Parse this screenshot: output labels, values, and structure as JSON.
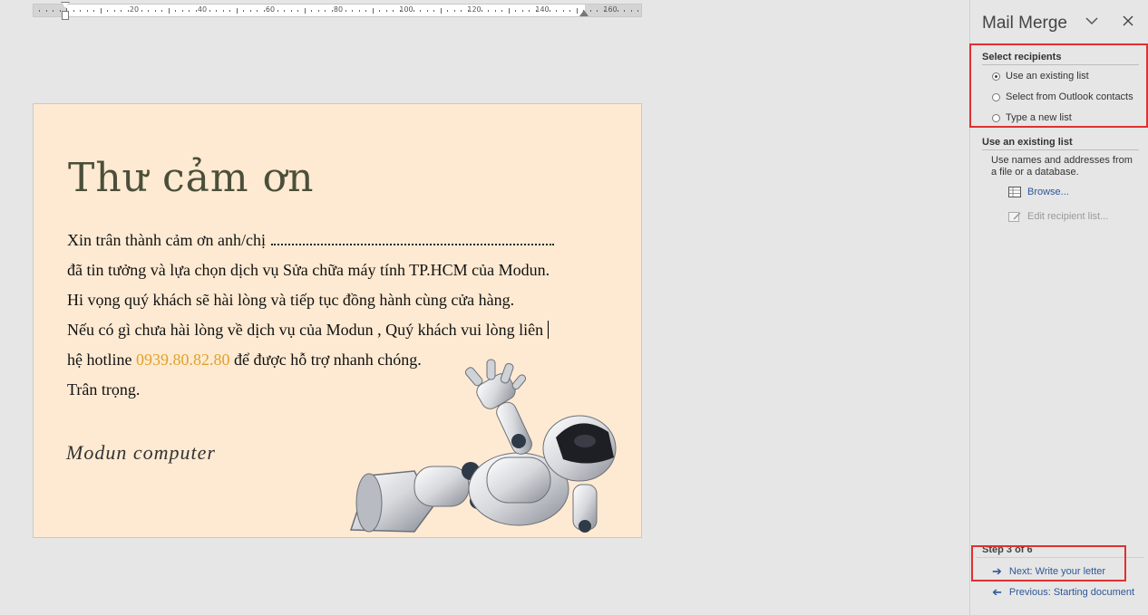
{
  "ruler": {
    "numbers": [
      "20",
      "40",
      "60",
      "80",
      "100",
      "120",
      "140",
      "160"
    ]
  },
  "document": {
    "title": "Thư cảm ơn",
    "line1": "Xin trân thành cảm ơn anh/chị",
    "line2": "đã tin tưởng và  lựa chọn dịch vụ Sửa chữa máy tính TP.HCM của Modun.",
    "line3": "Hi vọng quý khách sẽ hài lòng và tiếp tục đồng hành cùng cửa hàng.",
    "line4": "Nếu có gì chưa hài lòng về dịch vụ của Modun , Quý khách vui lòng liên",
    "line5_prefix": "hệ hotline ",
    "hotline": "0939.80.82.80",
    "line5_suffix": " để được hỗ trợ nhanh chóng.",
    "line6": "Trân trọng.",
    "signature": "Modun computer",
    "robot_image": "reclining-robot-illustration"
  },
  "mail_merge": {
    "title": "Mail Merge",
    "chevron_icon": "chevron-down-icon",
    "close_icon": "close-icon",
    "select_recipients_heading": "Select recipients",
    "options": [
      {
        "label": "Use an existing list",
        "selected": true
      },
      {
        "label": "Select from Outlook contacts",
        "selected": false
      },
      {
        "label": "Type a new list",
        "selected": false
      }
    ],
    "existing_list_heading": "Use an existing list",
    "existing_list_desc": "Use names and addresses from a file or a database.",
    "browse_label": "Browse...",
    "edit_label": "Edit recipient list...",
    "step_label": "Step 3 of 6",
    "next_label": "Next: Write your letter",
    "previous_label": "Previous: Starting document"
  },
  "colors": {
    "page_background": "#feead2",
    "title_color": "#4b4f3a",
    "hotline_color": "#e0a12a",
    "highlight_box": "#e03030",
    "link_color": "#2b5797"
  }
}
